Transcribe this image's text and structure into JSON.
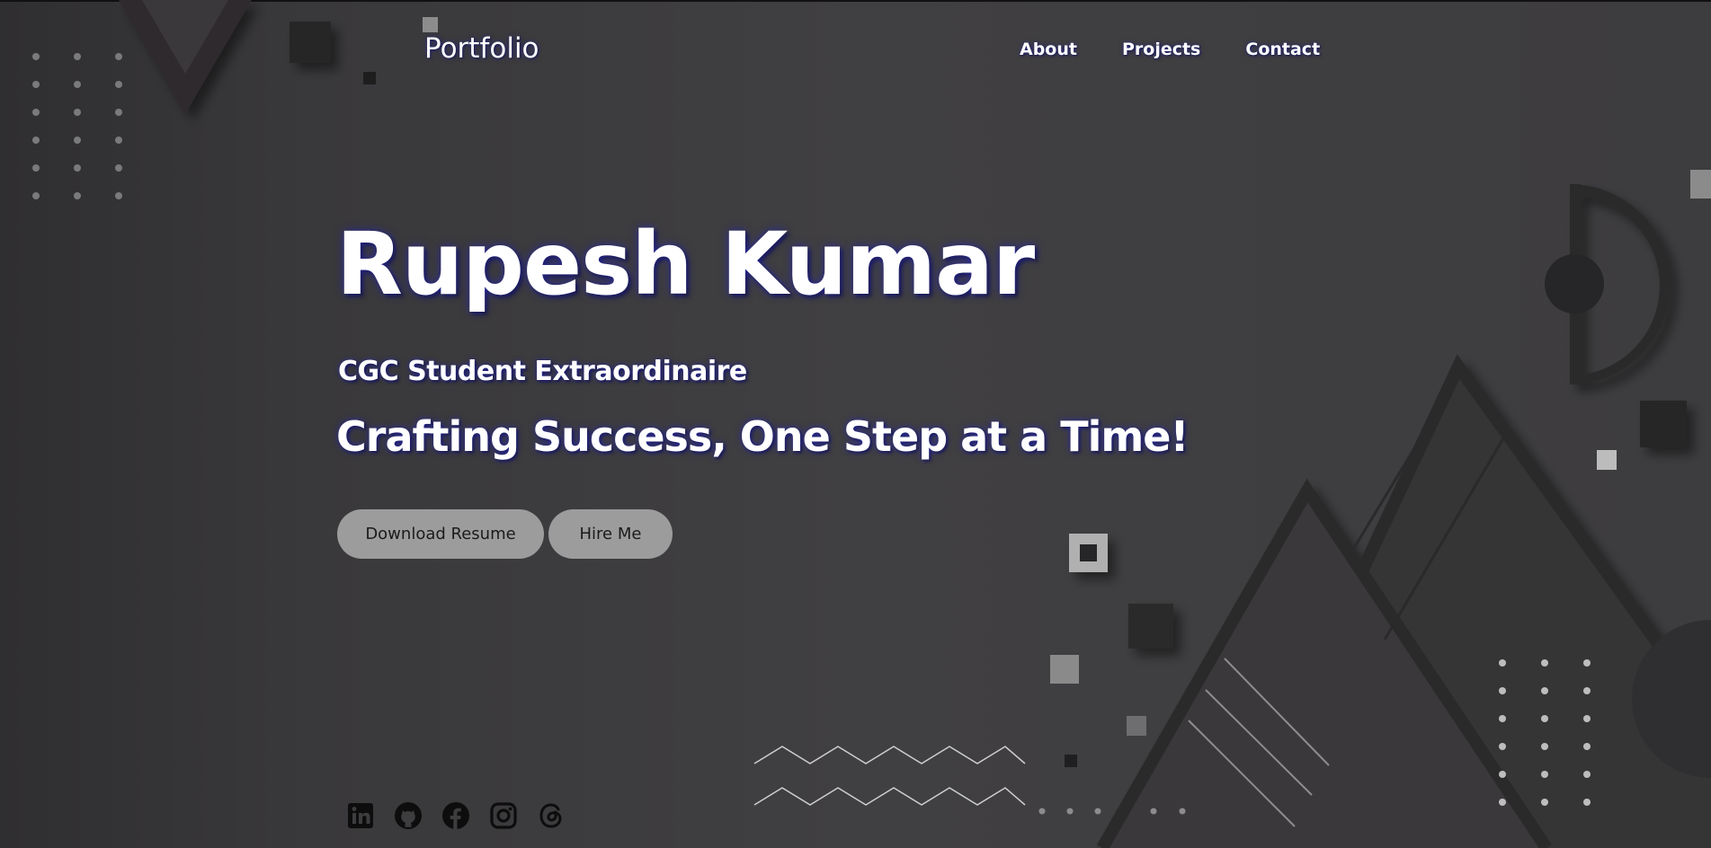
{
  "header": {
    "brand": "Portfolio",
    "nav": [
      {
        "label": "About"
      },
      {
        "label": "Projects"
      },
      {
        "label": "Contact"
      }
    ]
  },
  "hero": {
    "name": "Rupesh Kumar",
    "subtitle": "CGC Student Extraordinaire",
    "tagline": "Crafting Success, One Step at a Time!",
    "buttons": {
      "download_resume": "Download Resume",
      "hire_me": "Hire Me"
    }
  },
  "social": [
    "linkedin-icon",
    "github-icon",
    "facebook-icon",
    "instagram-icon",
    "threads-icon"
  ],
  "colors": {
    "background": "#3d3c3e",
    "text": "#ffffff",
    "text_glow": "#2a2aa0",
    "button_bg": "#9d9c9d",
    "button_text": "#1b1b1b"
  }
}
